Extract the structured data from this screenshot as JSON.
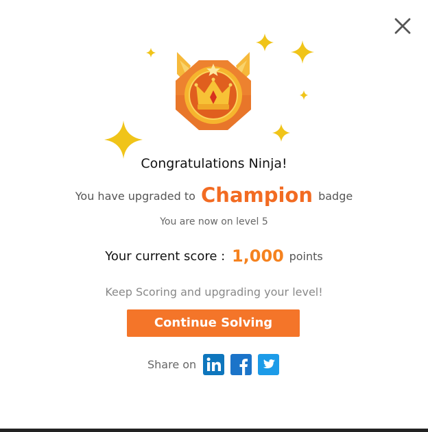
{
  "modal": {
    "close_icon": "close-icon",
    "badge_icon": "champion-crown-badge-icon",
    "congrats_text": "Congratulations Ninja!",
    "upgrade_prefix": "You have upgraded to",
    "badge_name": "Champion",
    "upgrade_suffix": "badge",
    "level_text": "You are now on level 5",
    "score_prefix": "Your current score :",
    "score_value": "1,000",
    "score_suffix": "points",
    "keep_text": "Keep Scoring and upgrading your level!",
    "continue_label": "Continue Solving",
    "share_label": "Share on",
    "share_icons": [
      "linkedin-icon",
      "facebook-icon",
      "twitter-icon"
    ]
  },
  "colors": {
    "accent_orange": "#f26b22",
    "button_orange": "#f47529",
    "score_orange": "#f5821f",
    "sparkle_yellow": "#f0c419",
    "linkedin_blue": "#0e76bd",
    "facebook_blue": "#1b74c9",
    "twitter_blue": "#1c9be8"
  }
}
